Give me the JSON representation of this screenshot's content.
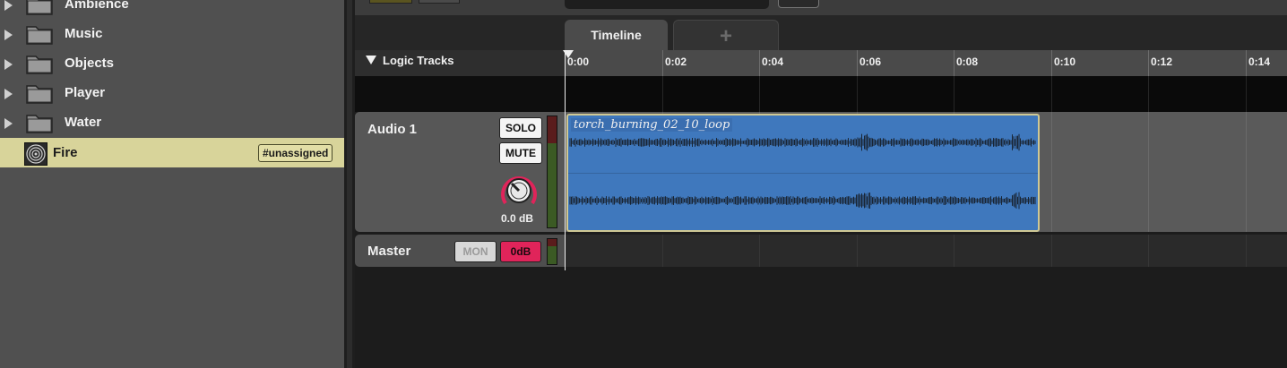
{
  "browser": {
    "folders": [
      {
        "label": "Ambience"
      },
      {
        "label": "Music"
      },
      {
        "label": "Objects"
      },
      {
        "label": "Player"
      },
      {
        "label": "Water"
      }
    ],
    "selected_event": {
      "label": "Fire",
      "badge": "#unassigned"
    }
  },
  "tabs": {
    "timeline": "Timeline",
    "add": "+"
  },
  "logic": {
    "label": "Logic Tracks"
  },
  "ruler": {
    "ticks": [
      "0:00",
      "0:02",
      "0:04",
      "0:06",
      "0:08",
      "0:10",
      "0:12",
      "0:14"
    ]
  },
  "audio_track": {
    "name": "Audio 1",
    "solo": "SOLO",
    "mute": "MUTE",
    "volume": "0.0 dB",
    "clip_name": "torch_burning_02_10_loop"
  },
  "master_track": {
    "name": "Master",
    "mon": "MON",
    "db": "0dB"
  },
  "colors": {
    "selection": "#d8d49a",
    "clip": "#3f78bd",
    "accent": "#e0245a"
  }
}
